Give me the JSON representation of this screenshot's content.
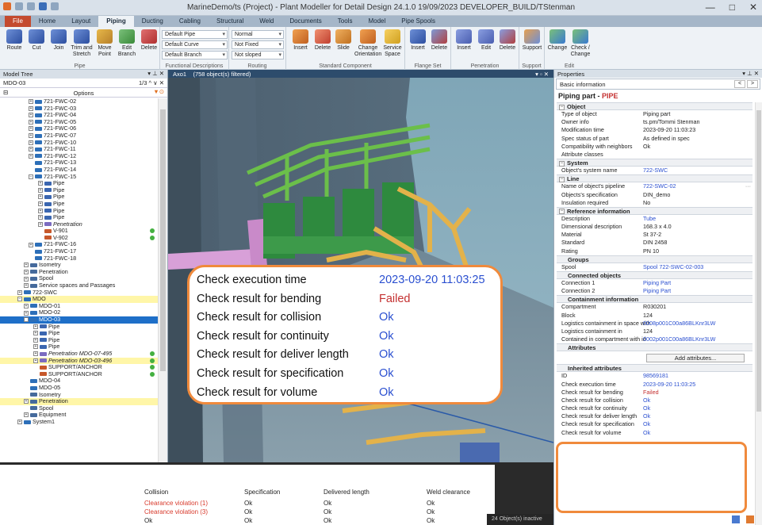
{
  "window": {
    "title": "MarineDemo/ts (Project) - Plant Modeller for Detail Design 24.1.0 19/09/2023 DEVELOPER_BUILD/TStenman",
    "minimize": "—",
    "maximize": "□",
    "close": "✕"
  },
  "ribbon_tabs": [
    "File",
    "Home",
    "Layout",
    "Piping",
    "Ducting",
    "Cabling",
    "Structural",
    "Weld",
    "Documents",
    "Tools",
    "Model",
    "Pipe Spools"
  ],
  "ribbon": {
    "pipe_group": {
      "name": "Pipe",
      "buttons": [
        "Route",
        "Cut",
        "Join",
        "Trim and Stretch",
        "Move Point",
        "Edit Branch",
        "Delete"
      ]
    },
    "functional_group": {
      "name": "Functional Descriptions",
      "selects": [
        "Default Pipe",
        "Default Curve",
        "Default Branch"
      ]
    },
    "routing_group": {
      "name": "Routing",
      "selects": [
        "Normal",
        "Not Fixed",
        "Not sloped"
      ]
    },
    "standard_group": {
      "name": "Standard Component",
      "buttons": [
        "Insert",
        "Delete",
        "Slide",
        "Change Orientation",
        "Service Space"
      ]
    },
    "flange_group": {
      "name": "Flange Set",
      "buttons": [
        "Insert",
        "Delete"
      ]
    },
    "penetration_group": {
      "name": "Penetration",
      "buttons": [
        "Insert",
        "Edit",
        "Delete"
      ]
    },
    "support_group": {
      "name": "Support",
      "buttons": [
        "Support"
      ]
    },
    "edit_group": {
      "name": "Edit",
      "buttons": [
        "Change",
        "Check / Change"
      ]
    }
  },
  "model_tree": {
    "header": "Model Tree",
    "header_ctrl": "▾ ⊥ ✕",
    "search_value": "MDO-03",
    "match_count": "1/3 ^ ∨ ✕",
    "options_label": "Options",
    "collapse": "⊟",
    "filter": "▼⊙",
    "rows": [
      {
        "indent": 36,
        "exp": "+",
        "label": "721-FWC-02",
        "icon": "#2d6fb8"
      },
      {
        "indent": 36,
        "exp": "+",
        "label": "721-FWC-03",
        "icon": "#2d6fb8"
      },
      {
        "indent": 36,
        "exp": "+",
        "label": "721-FWC-04",
        "icon": "#2d6fb8"
      },
      {
        "indent": 36,
        "exp": "+",
        "label": "721-FWC-05",
        "icon": "#2d6fb8"
      },
      {
        "indent": 36,
        "exp": "+",
        "label": "721-FWC-06",
        "icon": "#2d6fb8"
      },
      {
        "indent": 36,
        "exp": "+",
        "label": "721-FWC-07",
        "icon": "#2d6fb8"
      },
      {
        "indent": 36,
        "exp": "+",
        "label": "721-FWC-10",
        "icon": "#2d6fb8"
      },
      {
        "indent": 36,
        "exp": "+",
        "label": "721-FWC-11",
        "icon": "#2d6fb8"
      },
      {
        "indent": 36,
        "exp": "+",
        "label": "721-FWC-12",
        "icon": "#2d6fb8"
      },
      {
        "indent": 44,
        "exp": "",
        "label": "721-FWC-13",
        "icon": "#2d6fb8"
      },
      {
        "indent": 44,
        "exp": "",
        "label": "721-FWC-14",
        "icon": "#2d6fb8"
      },
      {
        "indent": 36,
        "exp": "−",
        "label": "721-FWC-15",
        "icon": "#2d6fb8"
      },
      {
        "indent": 48,
        "exp": "+",
        "label": "Pipe",
        "icon": "#3b66b0"
      },
      {
        "indent": 48,
        "exp": "+",
        "label": "Pipe",
        "icon": "#3b66b0"
      },
      {
        "indent": 48,
        "exp": "+",
        "label": "Pipe",
        "icon": "#3b66b0"
      },
      {
        "indent": 48,
        "exp": "+",
        "label": "Pipe",
        "icon": "#3b66b0"
      },
      {
        "indent": 48,
        "exp": "+",
        "label": "Pipe",
        "icon": "#3b66b0"
      },
      {
        "indent": 48,
        "exp": "+",
        "label": "Pipe",
        "icon": "#3b66b0"
      },
      {
        "indent": 48,
        "exp": "+",
        "label": "Penetration",
        "icon": "#7b6bc0",
        "italic": true
      },
      {
        "indent": 56,
        "exp": "",
        "label": "V-901",
        "icon": "#c7582b",
        "ok": true
      },
      {
        "indent": 56,
        "exp": "",
        "label": "V-902",
        "icon": "#c7582b",
        "ok": true
      },
      {
        "indent": 36,
        "exp": "+",
        "label": "721-FWC-16",
        "icon": "#2d6fb8"
      },
      {
        "indent": 44,
        "exp": "",
        "label": "721-FWC-17",
        "icon": "#2d6fb8"
      },
      {
        "indent": 44,
        "exp": "",
        "label": "721-FWC-18",
        "icon": "#2d6fb8"
      },
      {
        "indent": 30,
        "exp": "+",
        "label": "Isometry",
        "icon": "#456a9c"
      },
      {
        "indent": 30,
        "exp": "+",
        "label": "Penetration",
        "icon": "#456a9c"
      },
      {
        "indent": 30,
        "exp": "+",
        "label": "Spool",
        "icon": "#456a9c"
      },
      {
        "indent": 30,
        "exp": "+",
        "label": "Service spaces and Passages",
        "icon": "#456a9c"
      },
      {
        "indent": 22,
        "exp": "+",
        "label": "722-SWC",
        "icon": "#2d6fb8"
      },
      {
        "indent": 22,
        "exp": "−",
        "label": "MDO",
        "icon": "#2d6fb8",
        "hl": "yellow"
      },
      {
        "indent": 30,
        "exp": "+",
        "label": "MDO-01",
        "icon": "#2d6fb8"
      },
      {
        "indent": 30,
        "exp": "+",
        "label": "MDO-02",
        "icon": "#2d6fb8"
      },
      {
        "indent": 30,
        "exp": "−",
        "label": "MDO-03",
        "icon": "#2d6fb8",
        "hl": "blue"
      },
      {
        "indent": 42,
        "exp": "+",
        "label": "Pipe",
        "icon": "#3b66b0"
      },
      {
        "indent": 42,
        "exp": "+",
        "label": "Pipe",
        "icon": "#3b66b0"
      },
      {
        "indent": 42,
        "exp": "+",
        "label": "Pipe",
        "icon": "#3b66b0"
      },
      {
        "indent": 42,
        "exp": "+",
        "label": "Pipe",
        "icon": "#3b66b0"
      },
      {
        "indent": 42,
        "exp": "+",
        "label": "Penetration MDO-07-495",
        "icon": "#7b6bc0",
        "italic": true,
        "ok": true
      },
      {
        "indent": 42,
        "exp": "+",
        "label": "Penetration MDO-03-496",
        "icon": "#7b6bc0",
        "italic": true,
        "ok": true,
        "hl": "yellow"
      },
      {
        "indent": 50,
        "exp": "",
        "label": "SUPPORT/ANCHOR",
        "icon": "#c7582b",
        "ok": true
      },
      {
        "indent": 50,
        "exp": "",
        "label": "SUPPORT/ANCHOR",
        "icon": "#c7582b",
        "ok": true
      },
      {
        "indent": 38,
        "exp": "",
        "label": "MDO-04",
        "icon": "#2d6fb8"
      },
      {
        "indent": 38,
        "exp": "",
        "label": "MDO-05",
        "icon": "#2d6fb8"
      },
      {
        "indent": 38,
        "exp": "",
        "label": "Isometry",
        "icon": "#456a9c"
      },
      {
        "indent": 30,
        "exp": "+",
        "label": "Penetration",
        "icon": "#456a9c",
        "hl": "yellow"
      },
      {
        "indent": 38,
        "exp": "",
        "label": "Spool",
        "icon": "#456a9c"
      },
      {
        "indent": 30,
        "exp": "+",
        "label": "Equipment",
        "icon": "#456a9c"
      },
      {
        "indent": 22,
        "exp": "+",
        "label": "System1",
        "icon": "#2d6fb8"
      }
    ]
  },
  "viewport": {
    "tab_label": "Axo1",
    "status": "(758 object(s) filtered)",
    "ctrl": "▾ ▫ ✕"
  },
  "properties": {
    "header": "Properties",
    "header_ctrl": "▾ ⊥ ✕",
    "view_select": "Basic information",
    "nav_prev": "<",
    "nav_next": ">",
    "title_prefix": "Piping part - ",
    "title_type": "PIPE",
    "sections": [
      {
        "title": "Object",
        "box": "−",
        "rows": [
          {
            "k": "Type of object",
            "v": "Piping part"
          },
          {
            "k": "Owner info",
            "v": "ts.pm/Tommi Stenman"
          },
          {
            "k": "Modification time",
            "v": "2023-09-20 11:03:23"
          },
          {
            "k": "Spec status of part",
            "v": "As defined in spec"
          },
          {
            "k": "Compatibility with neighbors",
            "v": "Ok"
          },
          {
            "k": "Attribute classes",
            "v": ""
          }
        ]
      },
      {
        "title": "System",
        "box": "−",
        "rows": [
          {
            "k": "Object's system name",
            "v": "722-SWC",
            "link": true
          }
        ]
      },
      {
        "title": "Line",
        "box": "−",
        "rows": [
          {
            "k": "Name of object's pipeline",
            "v": "722-SWC-02",
            "link": true,
            "dots": "···"
          },
          {
            "k": "Objects's specification",
            "v": "DIN_demo"
          },
          {
            "k": "Insulation required",
            "v": "No"
          }
        ]
      },
      {
        "title": "Reference information",
        "box": "−",
        "rows": [
          {
            "k": "Description",
            "v": "Tube",
            "link": true
          },
          {
            "k": "Dimensional description",
            "v": "168.3 x 4.0"
          },
          {
            "k": "Material",
            "v": "St 37-2"
          },
          {
            "k": "Standard",
            "v": "DIN 2458"
          },
          {
            "k": "Rating",
            "v": "PN 10"
          }
        ]
      },
      {
        "title": "Groups",
        "indent": true,
        "rows": [
          {
            "k": "Spool",
            "v": "Spool 722-SWC-02-003",
            "link": true
          }
        ]
      },
      {
        "title": "Connected objects",
        "indent": true,
        "rows": [
          {
            "k": "Connection 1",
            "v": "Piping Part",
            "link": true
          },
          {
            "k": "Connection 2",
            "v": "Piping Part",
            "link": true
          }
        ]
      },
      {
        "title": "Containment information",
        "indent": true,
        "rows": [
          {
            "k": "Compartment",
            "v": "R030201"
          },
          {
            "k": "Block",
            "v": "124"
          },
          {
            "k": "Logistics containment in space with",
            "v": "0008p001C00a86BLKnr3LW",
            "link": true
          },
          {
            "k": "Logistics containment in",
            "v": "124"
          },
          {
            "k": "Contained in compartment with id",
            "v": "0002p001C00a86BLKnr3LW",
            "link": true
          }
        ]
      },
      {
        "title": "Attributes",
        "indent": true,
        "button": "Add attributes...",
        "rows": []
      },
      {
        "title": "Inherited attributes",
        "indent": true,
        "rows": [
          {
            "k": "ID",
            "v": "98569181",
            "link": true
          },
          {
            "k": "Check execution time",
            "v": "2023-09-20 11:03:25",
            "link": true
          },
          {
            "k": "Check result for bending",
            "v": "Failed",
            "link": true
          },
          {
            "k": "Check result for collision",
            "v": "Ok",
            "link": true
          },
          {
            "k": "Check result for continuity",
            "v": "Ok",
            "link": true
          },
          {
            "k": "Check result for deliver length",
            "v": "Ok",
            "link": true
          },
          {
            "k": "Check result for specification",
            "v": "Ok",
            "link": true
          },
          {
            "k": "Check result for volume",
            "v": "Ok",
            "link": true
          }
        ]
      }
    ]
  },
  "callout": {
    "rows": [
      {
        "k": "Check execution time",
        "v": "2023-09-20 11:03:25"
      },
      {
        "k": "Check result for bending",
        "v": "Failed"
      },
      {
        "k": "Check result for collision",
        "v": "Ok"
      },
      {
        "k": "Check result for continuity",
        "v": "Ok"
      },
      {
        "k": "Check result for deliver length",
        "v": "Ok"
      },
      {
        "k": "Check result for specification",
        "v": "Ok"
      },
      {
        "k": "Check result for volume",
        "v": "Ok"
      }
    ]
  },
  "results_table": {
    "columns": [
      "Collision",
      "Specification",
      "Delivered length",
      "Weld clearance"
    ],
    "rows": [
      [
        "Clearance violation (1)",
        "Ok",
        "Ok",
        "Ok"
      ],
      [
        "Clearance violation (3)",
        "Ok",
        "Ok",
        "Ok"
      ],
      [
        "Ok",
        "Ok",
        "Ok",
        "Ok"
      ]
    ]
  },
  "statusbar": {
    "text": "24 Object(s) inactive"
  },
  "colors": {
    "accent_orange": "#f08a3c",
    "link_blue": "#2a4fd0",
    "failed_red": "#c43030",
    "selection_blue": "#1e6fc8",
    "highlight_yellow": "#fff6a8",
    "file_tab": "#c44a2e"
  }
}
